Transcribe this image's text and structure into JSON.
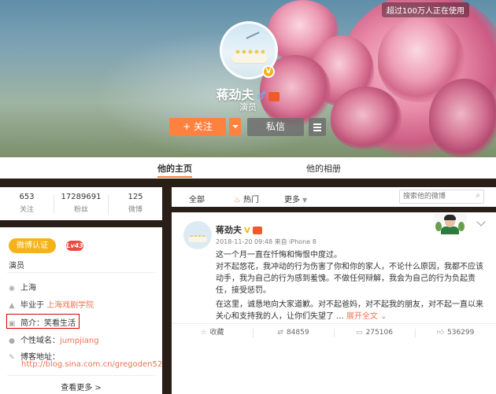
{
  "cover": {
    "online_badge": "超过100万人正在使用"
  },
  "profile": {
    "name": "蒋劲夫",
    "gender_symbol": "♂",
    "role": "演员",
    "verified_symbol": "V",
    "follow_label": "+ 关注",
    "message_label": "私信"
  },
  "tabs": {
    "home": "他的主页",
    "album": "他的相册"
  },
  "stats": [
    {
      "value": "653",
      "label": "关注"
    },
    {
      "value": "17289691",
      "label": "粉丝"
    },
    {
      "value": "125",
      "label": "微博"
    }
  ],
  "info": {
    "verified_label": "微博认证",
    "level": "Lv43",
    "role": "演员",
    "location": "上海",
    "school_prefix": "毕业于",
    "school": "上海戏剧学院",
    "bio": "简介：笑看生活",
    "domain_label": "个性域名：",
    "domain_value": "jumpjiang",
    "blog_label": "博客地址：",
    "blog_url": "http://blog.sina.com.cn/gregoden52",
    "more": "查看更多 >"
  },
  "filter": {
    "all": "全部",
    "hot": "热门",
    "more": "更多",
    "search_placeholder": "搜索他的微博"
  },
  "post": {
    "author": "蒋劲夫",
    "verified_symbol": "V",
    "meta": "2018-11-20 09:48 来自 iPhone 8",
    "line1": "这一个月一直在忏悔和悔恨中度过。",
    "line2": "对不起悠花，我冲动的行为伤害了你和你的家人，不论什么原因，我都不应该动手，我为自己的行为感到羞愧。不做任何辩解，我会为自己的行为负起责任，接受惩罚。",
    "line3": "在这里，诚恳地向大家道歉。对不起爸妈，对不起我的朋友，对不起一直以来关心和支持我的人，让你们失望了 ...",
    "expand": "展开全文 ⌄",
    "actions": {
      "fav": "收藏",
      "repost": "84859",
      "comment": "275106",
      "like": "536299"
    }
  },
  "colors": {
    "accent": "#ff8140",
    "link": "#eb7350",
    "verified": "#f6b21a"
  }
}
